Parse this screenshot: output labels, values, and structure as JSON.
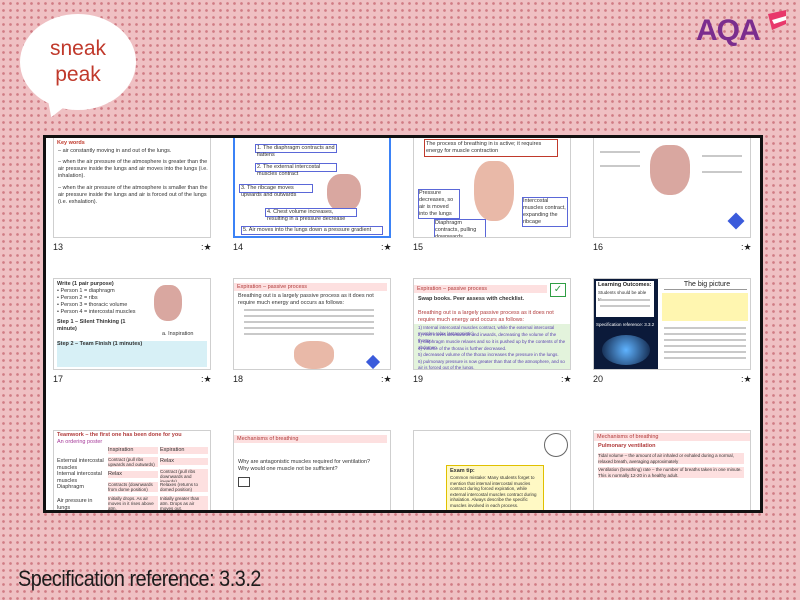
{
  "bubble": {
    "line1": "sneak",
    "line2": "peak"
  },
  "logo": {
    "text": "AQA"
  },
  "spec": {
    "text": "Specification reference: 3.3.2"
  },
  "slides": {
    "s13": {
      "num": "13",
      "header": "Key words",
      "b1": "– air constantly moving in and out of the lungs.",
      "b2": "– when the air pressure of the atmosphere is greater than the air pressure inside the lungs and air moves into the lungs (i.e. inhalation).",
      "b3": "– when the air pressure of the atmosphere is smaller than the air pressure inside the lungs and air is forced out of the lungs (i.e. exhalation)."
    },
    "s14": {
      "num": "14",
      "t1": "1. The diaphragm contracts and flattens",
      "t2": "2. The external intercostal muscles contract",
      "t3": "3. The ribcage moves upwards and outwards",
      "t4": "4. Chest volume increases, resulting in a pressure decrease",
      "t5": "5. Air moves into the lungs down a pressure gradient"
    },
    "s15": {
      "num": "15",
      "title": "The process of breathing in is active; it requires energy for muscle contraction",
      "c1": "Pressure decreases, so air is moved into the lungs",
      "c2": "Intercostal muscles contract, expanding the ribcage",
      "c3": "Diaphragm contracts, pulling downwards"
    },
    "s16": {
      "num": "16"
    },
    "s17": {
      "num": "17",
      "l1": "Write (1 pair purpose)",
      "l2": "• Person 1 = diaphragm",
      "l3": "• Person 2 = ribs",
      "l4": "• Person 3 = thoracic volume",
      "l5": "• Person 4 = intercostal muscles",
      "l6": "Step 1 – Silent Thinking (1 minute)",
      "l7": "Step 2 – Team Finish (1 minutes)",
      "caption": "a. Inspiration"
    },
    "s18": {
      "num": "18",
      "bar": "Expiration – passive process",
      "intro": "Breathing out is a largely passive process as it does not require much energy and occurs as follows:"
    },
    "s19": {
      "num": "19",
      "bar": "Expiration – passive process",
      "green": "Swap books. Peer assess with checklist.",
      "intro": "Breathing out is a largely passive process as it does not require much energy and occurs as follows:",
      "p1": "1) Internal intercostal muscles contract, while the external intercostal muscles relax (antagonistic).",
      "p2": "2) Also moves downwards and inwards, decreasing the volume of the thorax.",
      "p3": "3) diaphragm muscle relaxes and so it is pushed up by the contents of the abdomen",
      "p4": "4) volume of the thorax is further decreased.",
      "p5": "5) decreased volume of the thorax increases the pressure in the lungs.",
      "p6": "6) pulmonary pressure is now greater than that of the atmosphere, and so air is forced out of the lungs."
    },
    "s20": {
      "num": "20",
      "title": "The big picture",
      "lo": "Learning Outcomes:",
      "lo2": "Students should be able to...",
      "spec": "Specification reference: 3.3.2"
    },
    "s21": {
      "title": "Teamwork – the first one has been done for you",
      "sub": "An ordering poster",
      "col1": "Inspiration",
      "col2": "Expiration",
      "rows": [
        [
          "External intercostal muscles",
          "Contract (pull ribs upwards and outwards)",
          "Relax"
        ],
        [
          "Internal intercostal muscles",
          "Relax",
          "Contract (pull ribs downwards and inwards)"
        ],
        [
          "Diaphragm",
          "Contracts (downwards from dome position)",
          "Relaxes (returns to domed position)"
        ],
        [
          "Air pressure in lungs",
          "Initially drops. As air moves in it rises above atm.",
          "Initially greater than atm. Drops as air moves out."
        ]
      ]
    },
    "s22": {
      "bar": "Mechanisms of breathing",
      "q": "Why are antagonistic muscles required for ventilation? Why would one muscle not be sufficient?"
    },
    "s23": {
      "title": "Exam tip:",
      "body": "Common mistake: Many students forget to mention that internal intercostal muscles contract during forced expiration, while external intercostal muscles contract during inhalation. Always describe the specific muscles involved in each process."
    },
    "s24": {
      "bar": "Mechanisms of breathing",
      "h": "Pulmonary ventilation",
      "d1": "Tidal volume – the amount of air inhaled or exhaled during a normal, relaxed breath, averaging approximately",
      "d2": "Ventilation (breathing) rate – the number of breaths taken in one minute. This is normally 12-20 in a healthy adult."
    },
    "star": ":★"
  }
}
